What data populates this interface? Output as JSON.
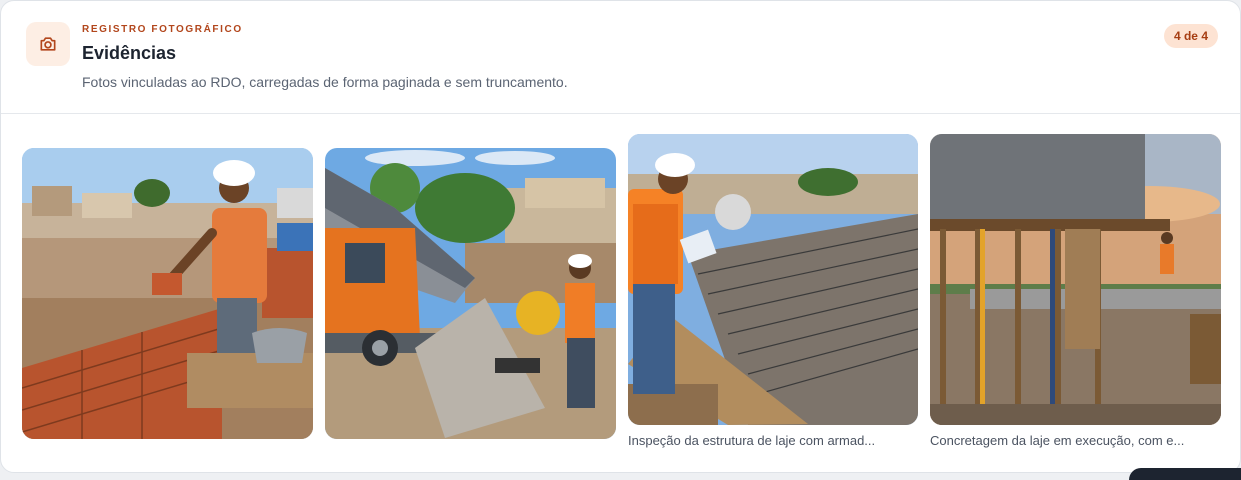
{
  "section": {
    "eyebrow": "REGISTRO FOTOGRÁFICO",
    "title": "Evidências",
    "description": "Fotos vinculadas ao RDO, carregadas de forma paginada e sem truncamento.",
    "count_badge": "4 de 4",
    "icon": "camera-icon",
    "accent_color": "#b2461c"
  },
  "photos": [
    {
      "scene": "bricklaying-worker",
      "caption": ""
    },
    {
      "scene": "dump-truck-concrete-mixer",
      "caption": ""
    },
    {
      "scene": "rebar-slab-inspection",
      "caption": "Inspeção da estrutura de laje com armad..."
    },
    {
      "scene": "slab-concreting-formwork",
      "caption": "Concretagem da laje em execução, com e..."
    }
  ]
}
